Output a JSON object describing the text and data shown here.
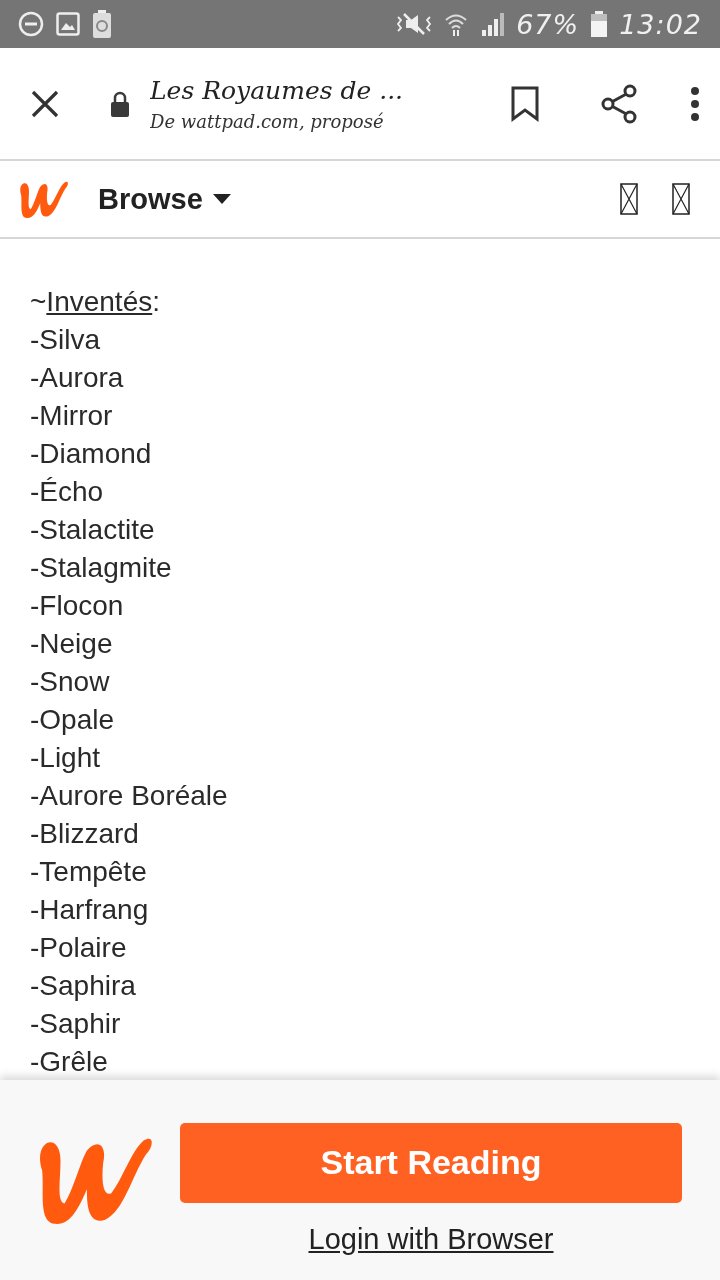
{
  "status_bar": {
    "battery_text": "67%",
    "time": "13:02"
  },
  "browser_bar": {
    "title": "Les Royaumes de ...",
    "subtitle": "De wattpad.com, proposé"
  },
  "app_header": {
    "menu_label": "Browse"
  },
  "content": {
    "heading": {
      "prefix": "~",
      "label": "Inventés",
      "suffix": ":"
    },
    "items": [
      "-Silva",
      "-Aurora",
      "-Mirror",
      "-Diamond",
      "-Écho",
      "-Stalactite",
      "-Stalagmite",
      "-Flocon",
      "-Neige",
      "-Snow",
      "-Opale",
      "-Light",
      "-Aurore Boréale",
      "-Blizzard",
      "-Tempête",
      "-Harfrang",
      "-Polaire",
      "-Saphira",
      "-Saphir",
      "-Grêle"
    ]
  },
  "footer": {
    "primary_button": "Start Reading",
    "link": "Login with Browser"
  }
}
